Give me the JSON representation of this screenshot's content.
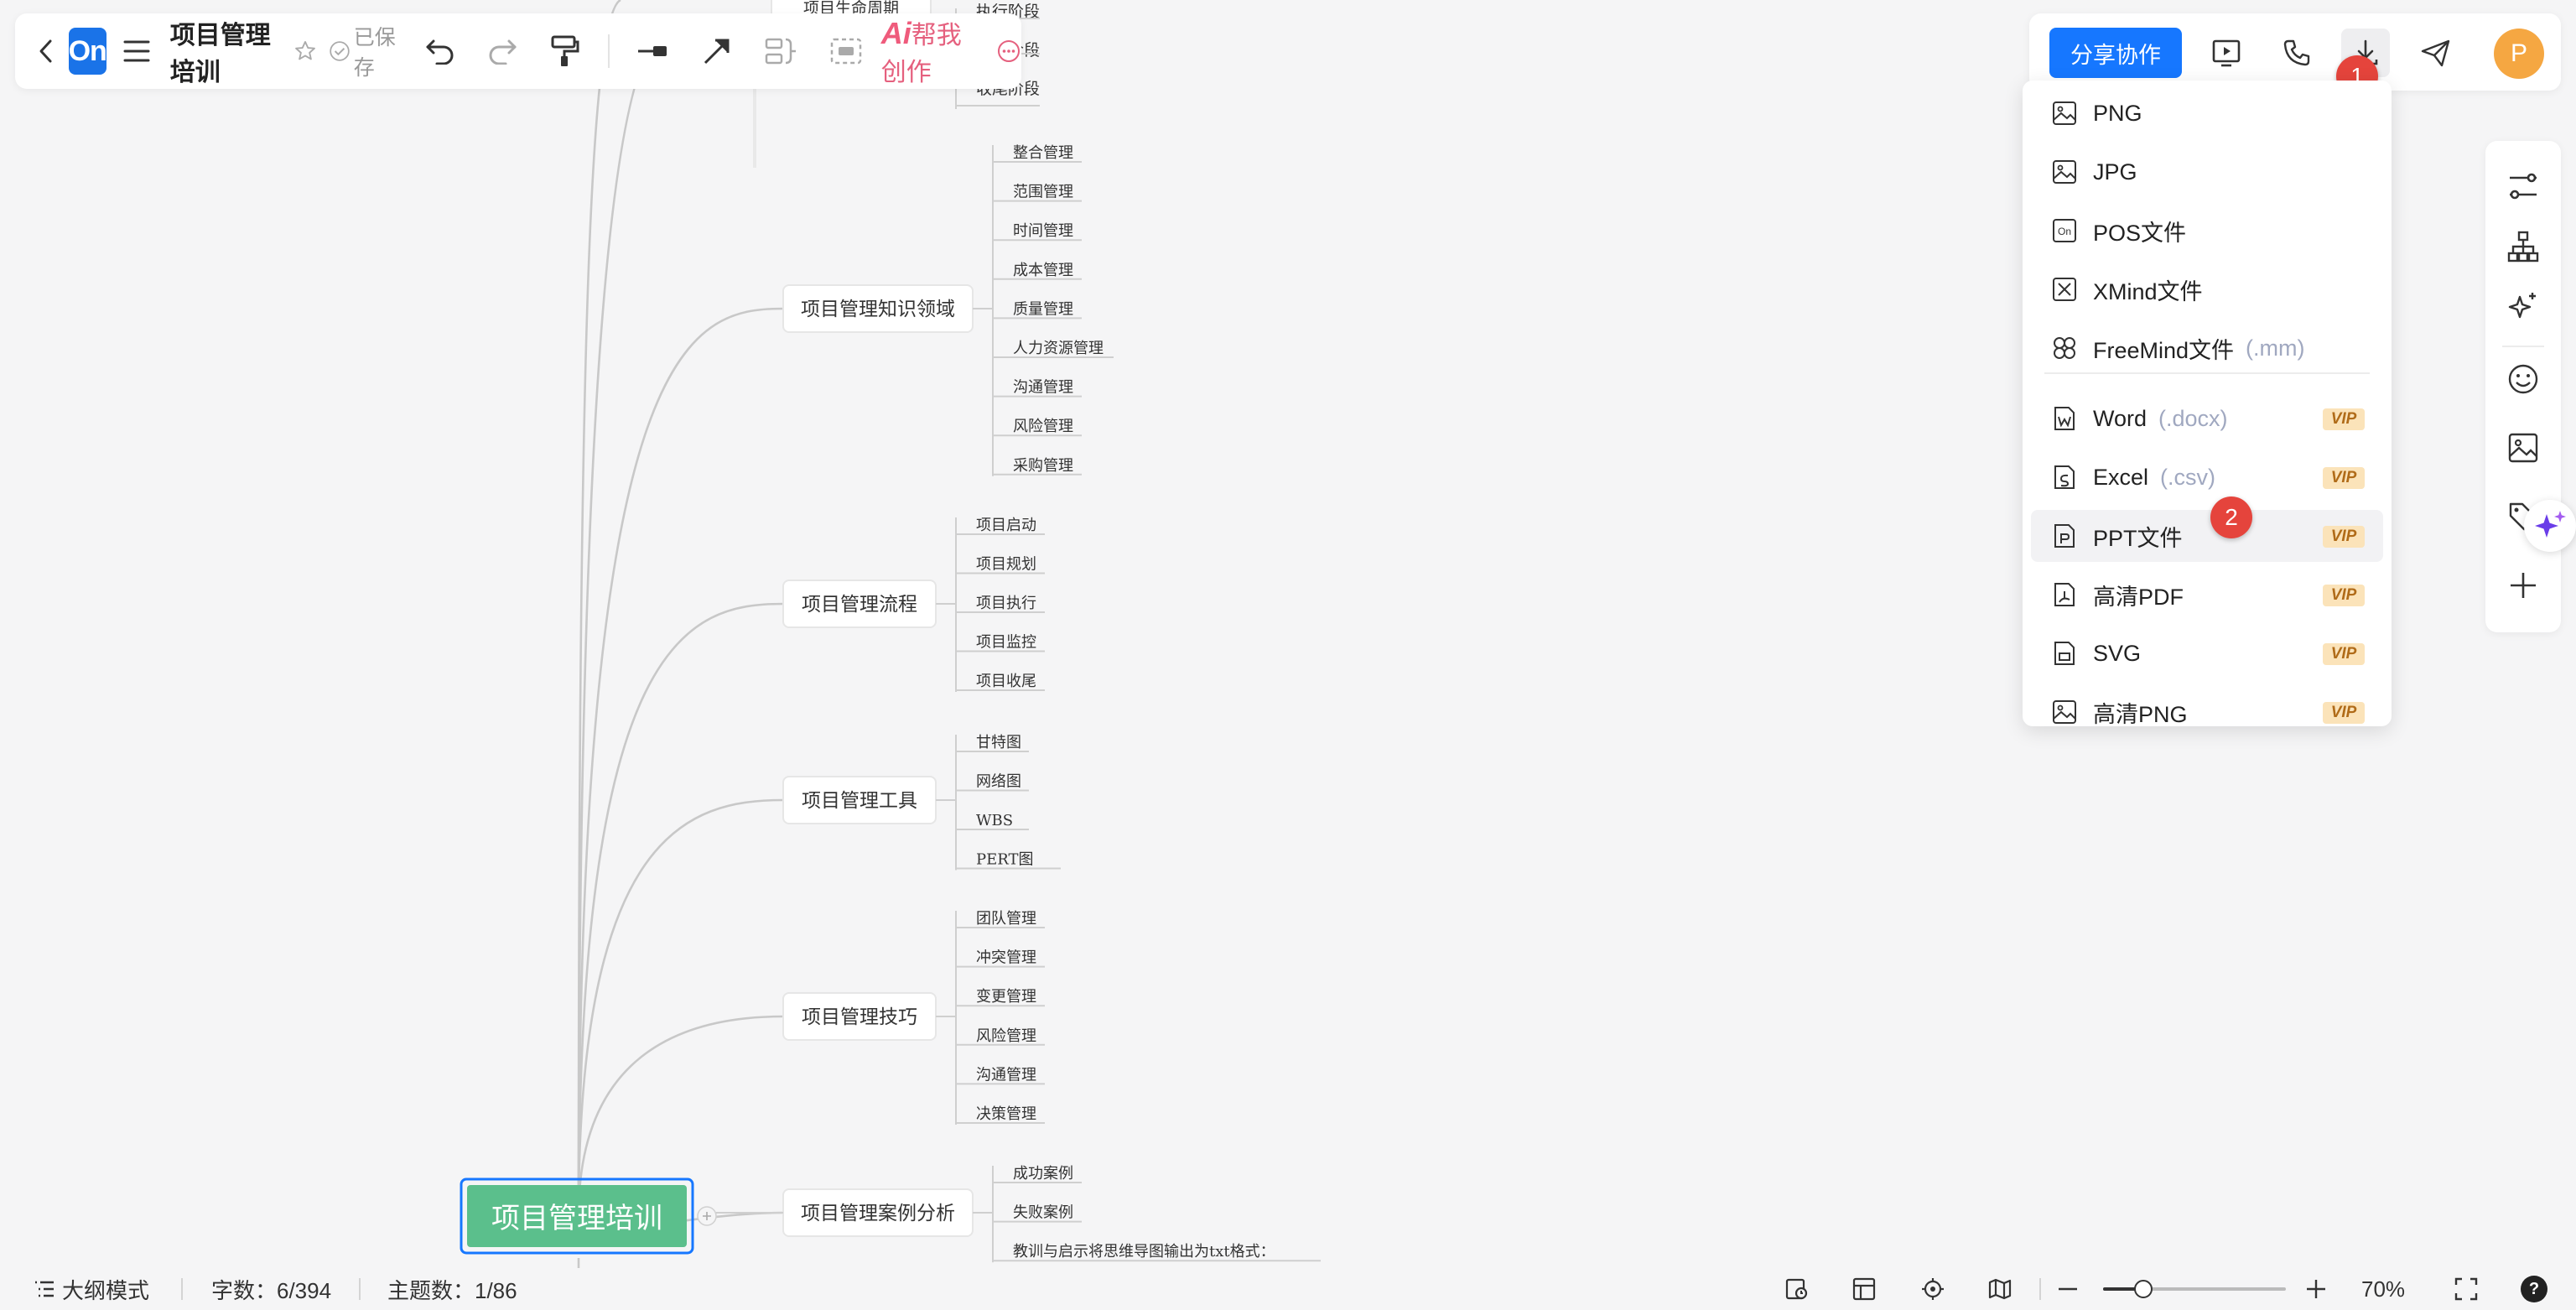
{
  "toolbar": {
    "logo_text": "On",
    "title": "项目管理培训",
    "saved_status": "已保存",
    "ai_prefix": "Ai",
    "ai_label": "帮我创作"
  },
  "rightbar": {
    "share_label": "分享协作",
    "avatar_initial": "P",
    "step1": "1"
  },
  "export_menu": {
    "items": [
      {
        "icon": "image-icon",
        "label": "PNG",
        "suffix": "",
        "vip": ""
      },
      {
        "icon": "image-icon",
        "label": "JPG",
        "suffix": "",
        "vip": ""
      },
      {
        "icon": "pos-file-icon",
        "label": "POS文件",
        "suffix": "",
        "vip": ""
      },
      {
        "icon": "xmind-icon",
        "label": "XMind文件",
        "suffix": "",
        "vip": ""
      },
      {
        "icon": "freemind-icon",
        "label": "FreeMind文件",
        "suffix": "(.mm)",
        "vip": ""
      },
      {
        "icon": "word-icon",
        "label": "Word",
        "suffix": "(.docx)",
        "vip": "VIP"
      },
      {
        "icon": "excel-icon",
        "label": "Excel",
        "suffix": "(.csv)",
        "vip": "VIP"
      },
      {
        "icon": "ppt-icon",
        "label": "PPT文件",
        "suffix": "",
        "vip": "VIP"
      },
      {
        "icon": "pdf-icon",
        "label": "高清PDF",
        "suffix": "",
        "vip": "VIP"
      },
      {
        "icon": "svg-icon",
        "label": "SVG",
        "suffix": "",
        "vip": "VIP"
      },
      {
        "icon": "image-icon",
        "label": "高清PNG",
        "suffix": "",
        "vip": "VIP"
      }
    ],
    "step2": "2"
  },
  "mindmap": {
    "root": "项目管理培训",
    "top_partial": {
      "label": "项目生命周期",
      "children": [
        "执行阶段",
        "监控阶段",
        "收尾阶段"
      ]
    },
    "branches": [
      {
        "label": "项目管理知识领域",
        "children": [
          "整合管理",
          "范围管理",
          "时间管理",
          "成本管理",
          "质量管理",
          "人力资源管理",
          "沟通管理",
          "风险管理",
          "采购管理"
        ]
      },
      {
        "label": "项目管理流程",
        "children": [
          "项目启动",
          "项目规划",
          "项目执行",
          "项目监控",
          "项目收尾"
        ]
      },
      {
        "label": "项目管理工具",
        "children": [
          "甘特图",
          "网络图",
          "WBS",
          "PERT图"
        ]
      },
      {
        "label": "项目管理技巧",
        "children": [
          "团队管理",
          "冲突管理",
          "变更管理",
          "风险管理",
          "沟通管理",
          "决策管理"
        ]
      },
      {
        "label": "项目管理案例分析",
        "children": [
          "成功案例",
          "失败案例",
          "教训与启示将思维导图输出为txt格式："
        ]
      }
    ]
  },
  "statusbar": {
    "outline_mode": "大纲模式",
    "word_count": "字数：6/394",
    "topic_count": "主题数：1/86",
    "zoom": "70%",
    "help": "?",
    "zoom_fraction": 0.22
  }
}
